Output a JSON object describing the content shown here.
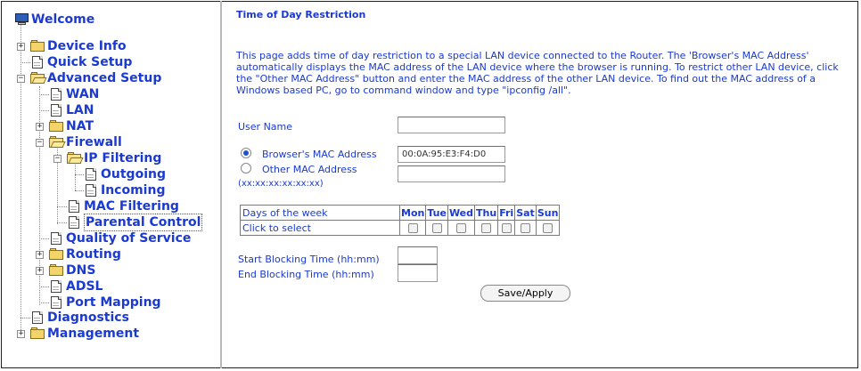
{
  "nav": {
    "root": "Welcome",
    "device_info": "Device Info",
    "quick_setup": "Quick Setup",
    "advanced_setup": "Advanced Setup",
    "wan": "WAN",
    "lan": "LAN",
    "nat": "NAT",
    "firewall": "Firewall",
    "ip_filtering": "IP Filtering",
    "outgoing": "Outgoing",
    "incoming": "Incoming",
    "mac_filtering": "MAC Filtering",
    "parental_control": "Parental Control",
    "quality_of_service": "Quality of Service",
    "routing": "Routing",
    "dns": "DNS",
    "adsl": "ADSL",
    "port_mapping": "Port Mapping",
    "diagnostics": "Diagnostics",
    "management": "Management",
    "selected": "Parental Control"
  },
  "page": {
    "title": "Time of Day Restriction",
    "description": "This page adds time of day restriction to a special LAN device connected to the Router. The 'Browser's MAC Address' automatically displays the MAC address of the LAN device where the browser is running. To restrict other LAN device, click the \"Other MAC Address\" button and enter the MAC address of the other LAN device. To find out the MAC address of a Windows based PC, go to command window and type \"ipconfig /all\"."
  },
  "form": {
    "user_name_label": "User Name",
    "user_name_value": "",
    "browser_mac_label": "Browser's MAC Address",
    "browser_mac_value": "00:0A:95:E3:F4:D0",
    "other_mac_label": "Other MAC Address",
    "other_mac_format": "(xx:xx:xx:xx:xx:xx)",
    "other_mac_value": "",
    "selected_mac_option": "browser",
    "days_header": "Days of the week",
    "click_to_select": "Click to select",
    "days": [
      "Mon",
      "Tue",
      "Wed",
      "Thu",
      "Fri",
      "Sat",
      "Sun"
    ],
    "days_checked": [
      false,
      false,
      false,
      false,
      false,
      false,
      false
    ],
    "start_time_label": "Start Blocking Time (hh:mm)",
    "start_time_value": "",
    "end_time_label": "End Blocking Time (hh:mm)",
    "end_time_value": "",
    "save_button": "Save/Apply"
  },
  "colors": {
    "link_text": "#1a3ad0",
    "radio_selected": "#1d55c9",
    "folder": "#f3d46b"
  },
  "icons": {
    "root": "monitor-icon",
    "folder": "folder-icon",
    "folder_open": "folder-open-icon",
    "page": "page-icon",
    "expand": "plus-box-icon",
    "collapse": "minus-box-icon"
  }
}
